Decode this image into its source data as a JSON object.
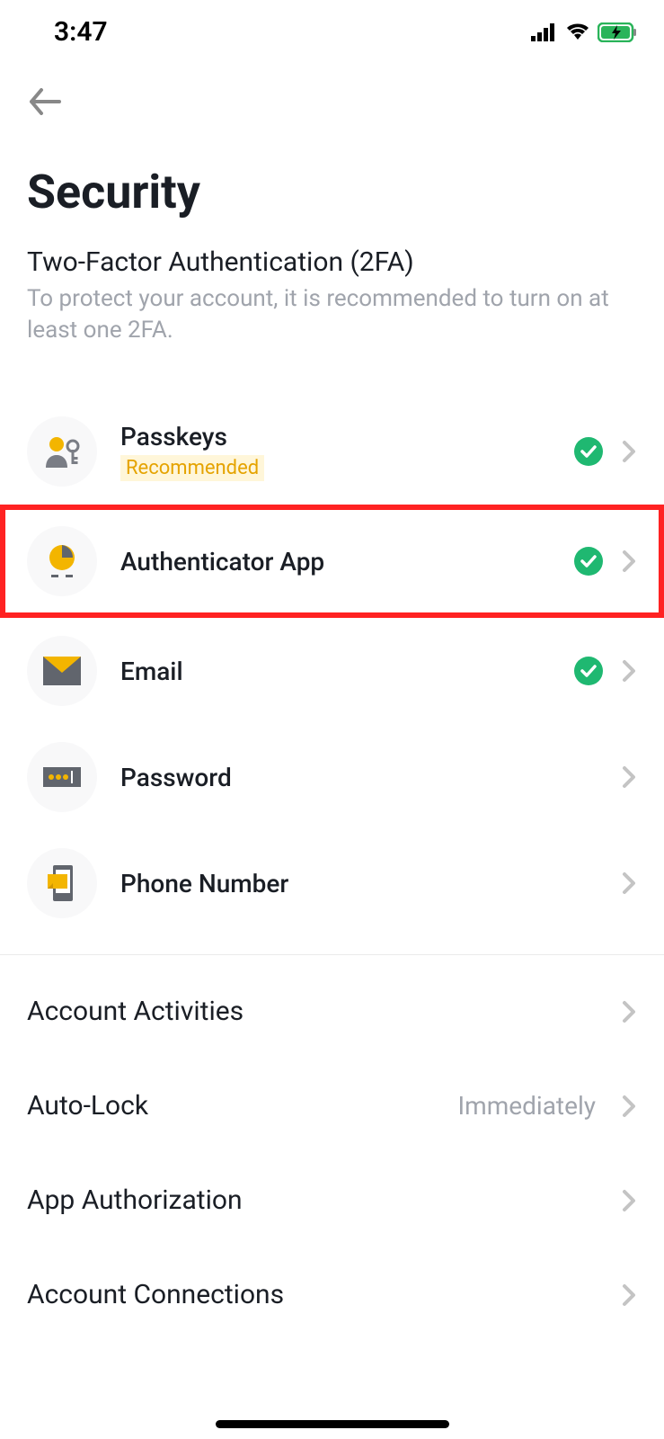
{
  "status_bar": {
    "time": "3:47"
  },
  "page": {
    "title": "Security"
  },
  "section": {
    "title": "Two-Factor Authentication (2FA)",
    "subtitle": "To protect your account, it is recommended to turn on at least one 2FA."
  },
  "tfa_items": [
    {
      "label": "Passkeys",
      "badge": "Recommended",
      "enabled": true,
      "highlighted": false
    },
    {
      "label": "Authenticator App",
      "badge": null,
      "enabled": true,
      "highlighted": true
    },
    {
      "label": "Email",
      "badge": null,
      "enabled": true,
      "highlighted": false
    },
    {
      "label": "Password",
      "badge": null,
      "enabled": false,
      "highlighted": false
    },
    {
      "label": "Phone Number",
      "badge": null,
      "enabled": false,
      "highlighted": false
    }
  ],
  "settings": [
    {
      "label": "Account Activities",
      "value": null
    },
    {
      "label": "Auto-Lock",
      "value": "Immediately"
    },
    {
      "label": "App Authorization",
      "value": null
    },
    {
      "label": "Account Connections",
      "value": null
    }
  ]
}
